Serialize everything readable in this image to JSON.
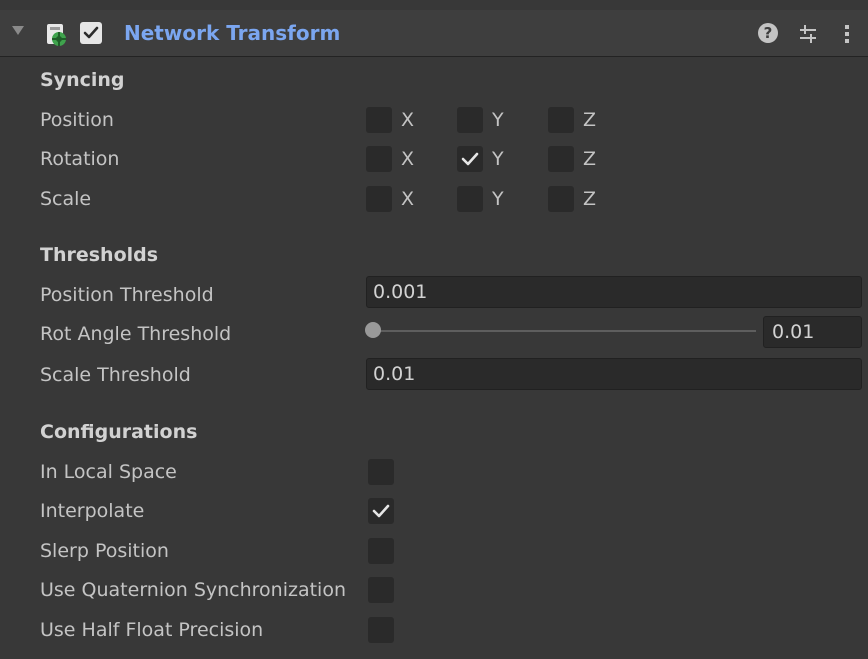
{
  "header": {
    "title": "Network Transform",
    "enabled": true,
    "icons": {
      "foldout": "triangle-down-icon",
      "component": "network-component-icon",
      "help": "help-icon",
      "presets": "presets-sliders-icon",
      "more": "more-vertical-icon"
    },
    "help_glyph": "?"
  },
  "syncing": {
    "title": "Syncing",
    "rows": [
      {
        "label": "Position",
        "x": false,
        "y": false,
        "z": false
      },
      {
        "label": "Rotation",
        "x": false,
        "y": true,
        "z": false
      },
      {
        "label": "Scale",
        "x": false,
        "y": false,
        "z": false
      }
    ],
    "axis_labels": {
      "x": "X",
      "y": "Y",
      "z": "Z"
    }
  },
  "thresholds": {
    "title": "Thresholds",
    "position_threshold": {
      "label": "Position Threshold",
      "value": "0.001"
    },
    "rot_angle_threshold": {
      "label": "Rot Angle Threshold",
      "value": "0.01",
      "slider_fraction": 0.0
    },
    "scale_threshold": {
      "label": "Scale Threshold",
      "value": "0.01"
    }
  },
  "configurations": {
    "title": "Configurations",
    "rows": [
      {
        "label": "In Local Space",
        "checked": false
      },
      {
        "label": "Interpolate",
        "checked": true
      },
      {
        "label": "Slerp Position",
        "checked": false
      },
      {
        "label": "Use Quaternion Synchronization",
        "checked": false
      },
      {
        "label": "Use Half Float Precision",
        "checked": false
      }
    ]
  },
  "colors": {
    "background": "#383838",
    "header_background": "#3e3e3e",
    "title_accent": "#7ba6f0",
    "field_background": "#2a2a2a",
    "text": "#c4c4c4"
  }
}
